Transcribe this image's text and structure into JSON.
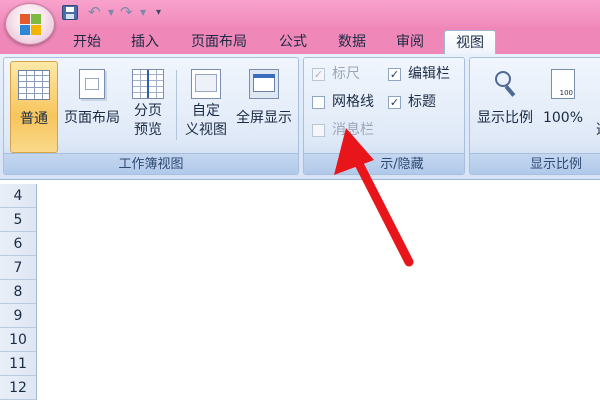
{
  "tabs": [
    "开始",
    "插入",
    "页面布局",
    "公式",
    "数据",
    "审阅",
    "视图"
  ],
  "workbook_views": {
    "label": "工作簿视图",
    "buttons": [
      {
        "label": "普通",
        "active": true
      },
      {
        "label": "页面布局"
      },
      {
        "label": "分页\n预览"
      },
      {
        "label": "自定\n义视图"
      },
      {
        "label": "全屏显示"
      }
    ]
  },
  "show_hide": {
    "label_visible": "示/隐藏",
    "items": [
      {
        "label": "标尺",
        "checked": true,
        "enabled": false
      },
      {
        "label": "网格线",
        "checked": false,
        "enabled": true
      },
      {
        "label": "消息栏",
        "checked": false,
        "enabled": false
      },
      {
        "label": "编辑栏",
        "checked": true,
        "enabled": true
      },
      {
        "label": "标题",
        "checked": true,
        "enabled": true
      }
    ]
  },
  "zoom": {
    "label": "显示比例",
    "buttons": [
      {
        "label": "显示比例"
      },
      {
        "label": "100%"
      },
      {
        "label_partial": "选"
      }
    ]
  },
  "row_headers": [
    "4",
    "5",
    "6",
    "7",
    "8",
    "9",
    "10",
    "11",
    "12"
  ],
  "icons": [
    "office-logo-icon",
    "save-icon",
    "undo-icon",
    "redo-icon",
    "customize-arrow-icon",
    "magnifier-icon"
  ],
  "colors": {
    "titlebar": "#ef87b8",
    "ribbon": "#dfe9f7",
    "active_button": "#f7c55c",
    "annotation_arrow": "#e8161a"
  }
}
